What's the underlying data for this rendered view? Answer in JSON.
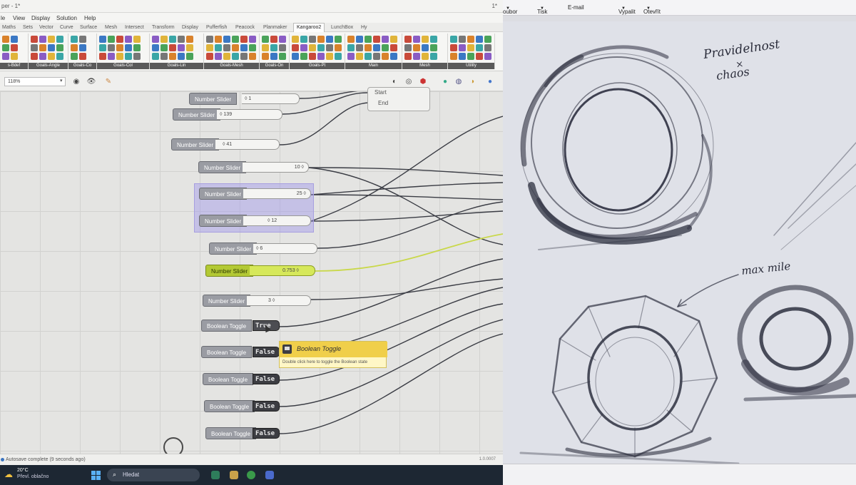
{
  "left_window": {
    "title_fragment": "per - 1*",
    "title_right": "1*",
    "menu": [
      "le",
      "View",
      "Display",
      "Solution",
      "Help"
    ],
    "tabs": [
      "Maths",
      "Sets",
      "Vector",
      "Curve",
      "Surface",
      "Mesh",
      "Intersect",
      "Transform",
      "Display",
      "Pufferfish",
      "Peacock",
      "Planmaker",
      "Kangaroo2",
      "LunchBox",
      "Hy"
    ],
    "active_tab": "Kangaroo2",
    "ribbon_groups": [
      "s-Bdef",
      "Goals-Angle",
      "Goals-Co",
      "Goals-Col",
      "Goals-Lin",
      "Goals-Mesh",
      "Goals-On",
      "Goals-Pt",
      "Main",
      "Mesh",
      "Utility"
    ],
    "zoom": "118%",
    "canvas": {
      "start_end": {
        "start": "Start",
        "end": "End"
      },
      "sliders": [
        {
          "label": "Number Slider",
          "value": "◊ 1"
        },
        {
          "label": "Number Slider",
          "value": "◊ 139"
        },
        {
          "label": "Number Slider",
          "value": "◊ 41"
        },
        {
          "label": "Number Slider",
          "value": "10 ◊"
        },
        {
          "label": "Number Slider",
          "value": "25 ◊"
        },
        {
          "label": "Number Slider",
          "value": "◊ 12"
        },
        {
          "label": "Number Slider",
          "value": "◊ 6"
        },
        {
          "label": "Number Slider",
          "value": "0.753 ◊"
        },
        {
          "label": "Number Slider",
          "value": "3 ◊"
        }
      ],
      "toggles": [
        {
          "label": "Boolean Toggle",
          "value": "True"
        },
        {
          "label": "Boolean Toggle",
          "value": "False"
        },
        {
          "label": "Boolean Toggle",
          "value": "False"
        },
        {
          "label": "Boolean Toggle",
          "value": "False"
        },
        {
          "label": "Boolean Toggle",
          "value": "False"
        }
      ],
      "tooltip": {
        "title": "Boolean Toggle",
        "description": "Double click here to toggle the Boolean state"
      },
      "wire_highlight_color": "#c9d84a"
    },
    "status": "Autosave complete (9 seconds ago)",
    "status_right": "1.0.0007",
    "taskbar": {
      "temperature": "20°C",
      "weather": "Převl. oblačno",
      "search": "Hledat"
    }
  },
  "right_window": {
    "menu": [
      "oubor",
      "Tisk",
      "E-mail",
      "Vypalit",
      "Otevřít"
    ],
    "handwriting": {
      "note1_line1": "Pravidelnost",
      "note1_line2": "×",
      "note1_line3": "chaos",
      "note2": "max mile"
    }
  },
  "icons": {
    "eye": "eye-icon",
    "brush": "brush-icon",
    "sphere": "sphere-icon",
    "windows": "windows-start-icon",
    "search": "search-icon",
    "weather": "cloud-sun-icon"
  }
}
